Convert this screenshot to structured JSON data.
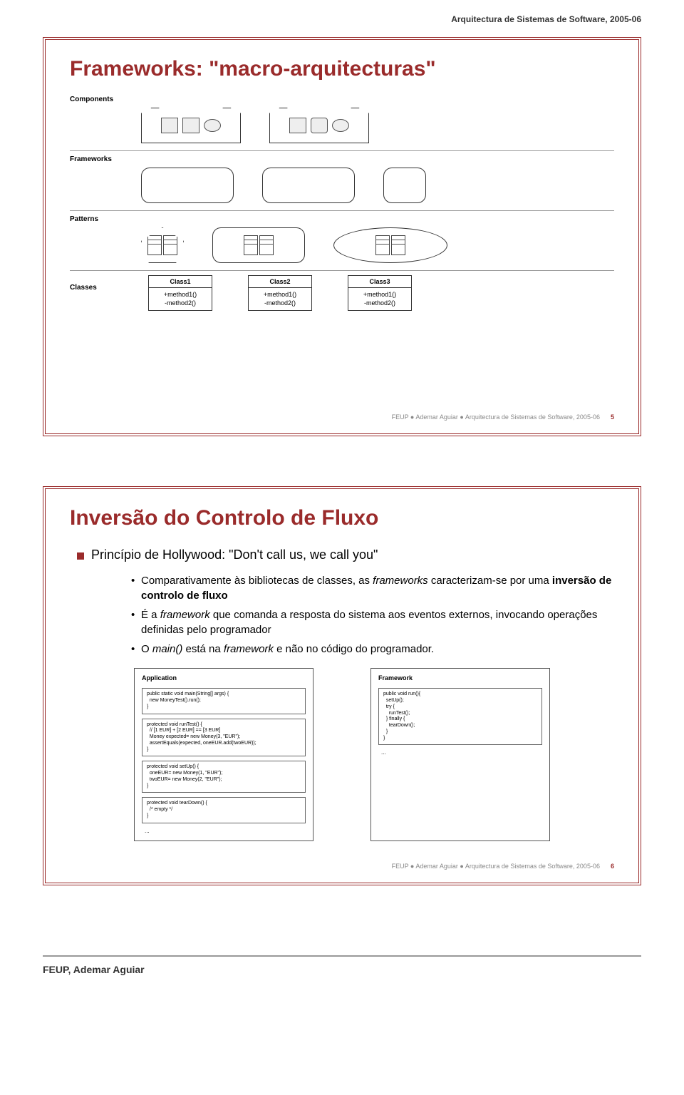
{
  "header": "Arquitectura de Sistemas de Software, 2005-06",
  "slide1": {
    "title": "Frameworks: \"macro-arquitecturas\"",
    "rows": {
      "components": "Components",
      "frameworks": "Frameworks",
      "patterns": "Patterns",
      "classes_label": "Classes"
    },
    "classes": [
      {
        "name": "Class1",
        "m1": "+method1()",
        "m2": "-method2()"
      },
      {
        "name": "Class2",
        "m1": "+method1()",
        "m2": "-method2()"
      },
      {
        "name": "Class3",
        "m1": "+method1()",
        "m2": "-method2()"
      }
    ],
    "footer_prefix": "FEUP",
    "footer_text": "Ademar Aguiar ● Arquitectura de Sistemas de Software, 2005-06",
    "footer_page": "5"
  },
  "slide2": {
    "title": "Inversão do Controlo de Fluxo",
    "lead_bullet": "Princípio de Hollywood: \"Don't call us, we call you\"",
    "sub": {
      "a1": "Comparativamente às bibliotecas de classes, as ",
      "a2": "frameworks",
      "a3": " caracterizam-se por uma ",
      "a4": "inversão de controlo de fluxo",
      "b1": "É a ",
      "b2": "framework",
      "b3": " que comanda a resposta do sistema aos eventos externos, invocando operações definidas pelo programador",
      "c1": "O ",
      "c2": "main()",
      "c3": " está na ",
      "c4": "framework",
      "c5": " e não no código do programador."
    },
    "app_label": "Application",
    "fw_label": "Framework",
    "code_app": [
      "public static void main(String[] args) {\n  new MoneyTest().run();\n}",
      "protected void runTest() {\n  // [1 EUR] + [2 EUR] == [3 EUR]\n  Money expected= new Money(3, \"EUR\");\n  assertEquals(expected, oneEUR.add(twoEUR));\n}",
      "protected void setUp() {\n  oneEUR= new Money(1, \"EUR\");\n  twoEUR= new Money(2, \"EUR\");\n}",
      "protected void tearDown() {\n  /* empty */\n}"
    ],
    "code_fw": [
      "public void run(){\n  setUp();\n  try {\n    runTest();\n  } finally {\n    tearDown();\n  }\n}"
    ],
    "ellipsis": "...",
    "footer_prefix": "FEUP",
    "footer_text": "Ademar Aguiar ● Arquitectura de Sistemas de Software, 2005-06",
    "footer_page": "6"
  },
  "page_footer": "FEUP, Ademar Aguiar"
}
